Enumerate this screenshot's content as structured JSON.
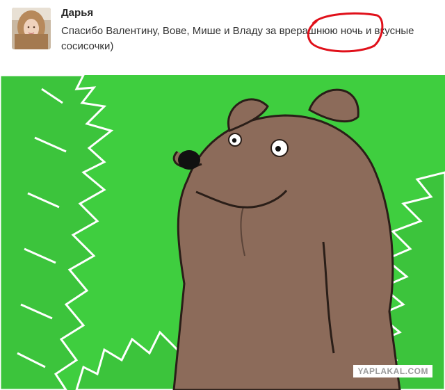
{
  "post": {
    "author": "Дарья",
    "message_before": "Спасибо Валентину, Вове, Мише и Владу за ",
    "highlighted_word": "врерашнюю",
    "message_after": " ночь и вкусные сосисочки)"
  },
  "image": {
    "watermark": "YAPLAKAL.COM"
  },
  "colors": {
    "highlight_circle": "#e0101a",
    "bush_green": "#3fce3f",
    "bear_brown": "#8c6b5a"
  }
}
